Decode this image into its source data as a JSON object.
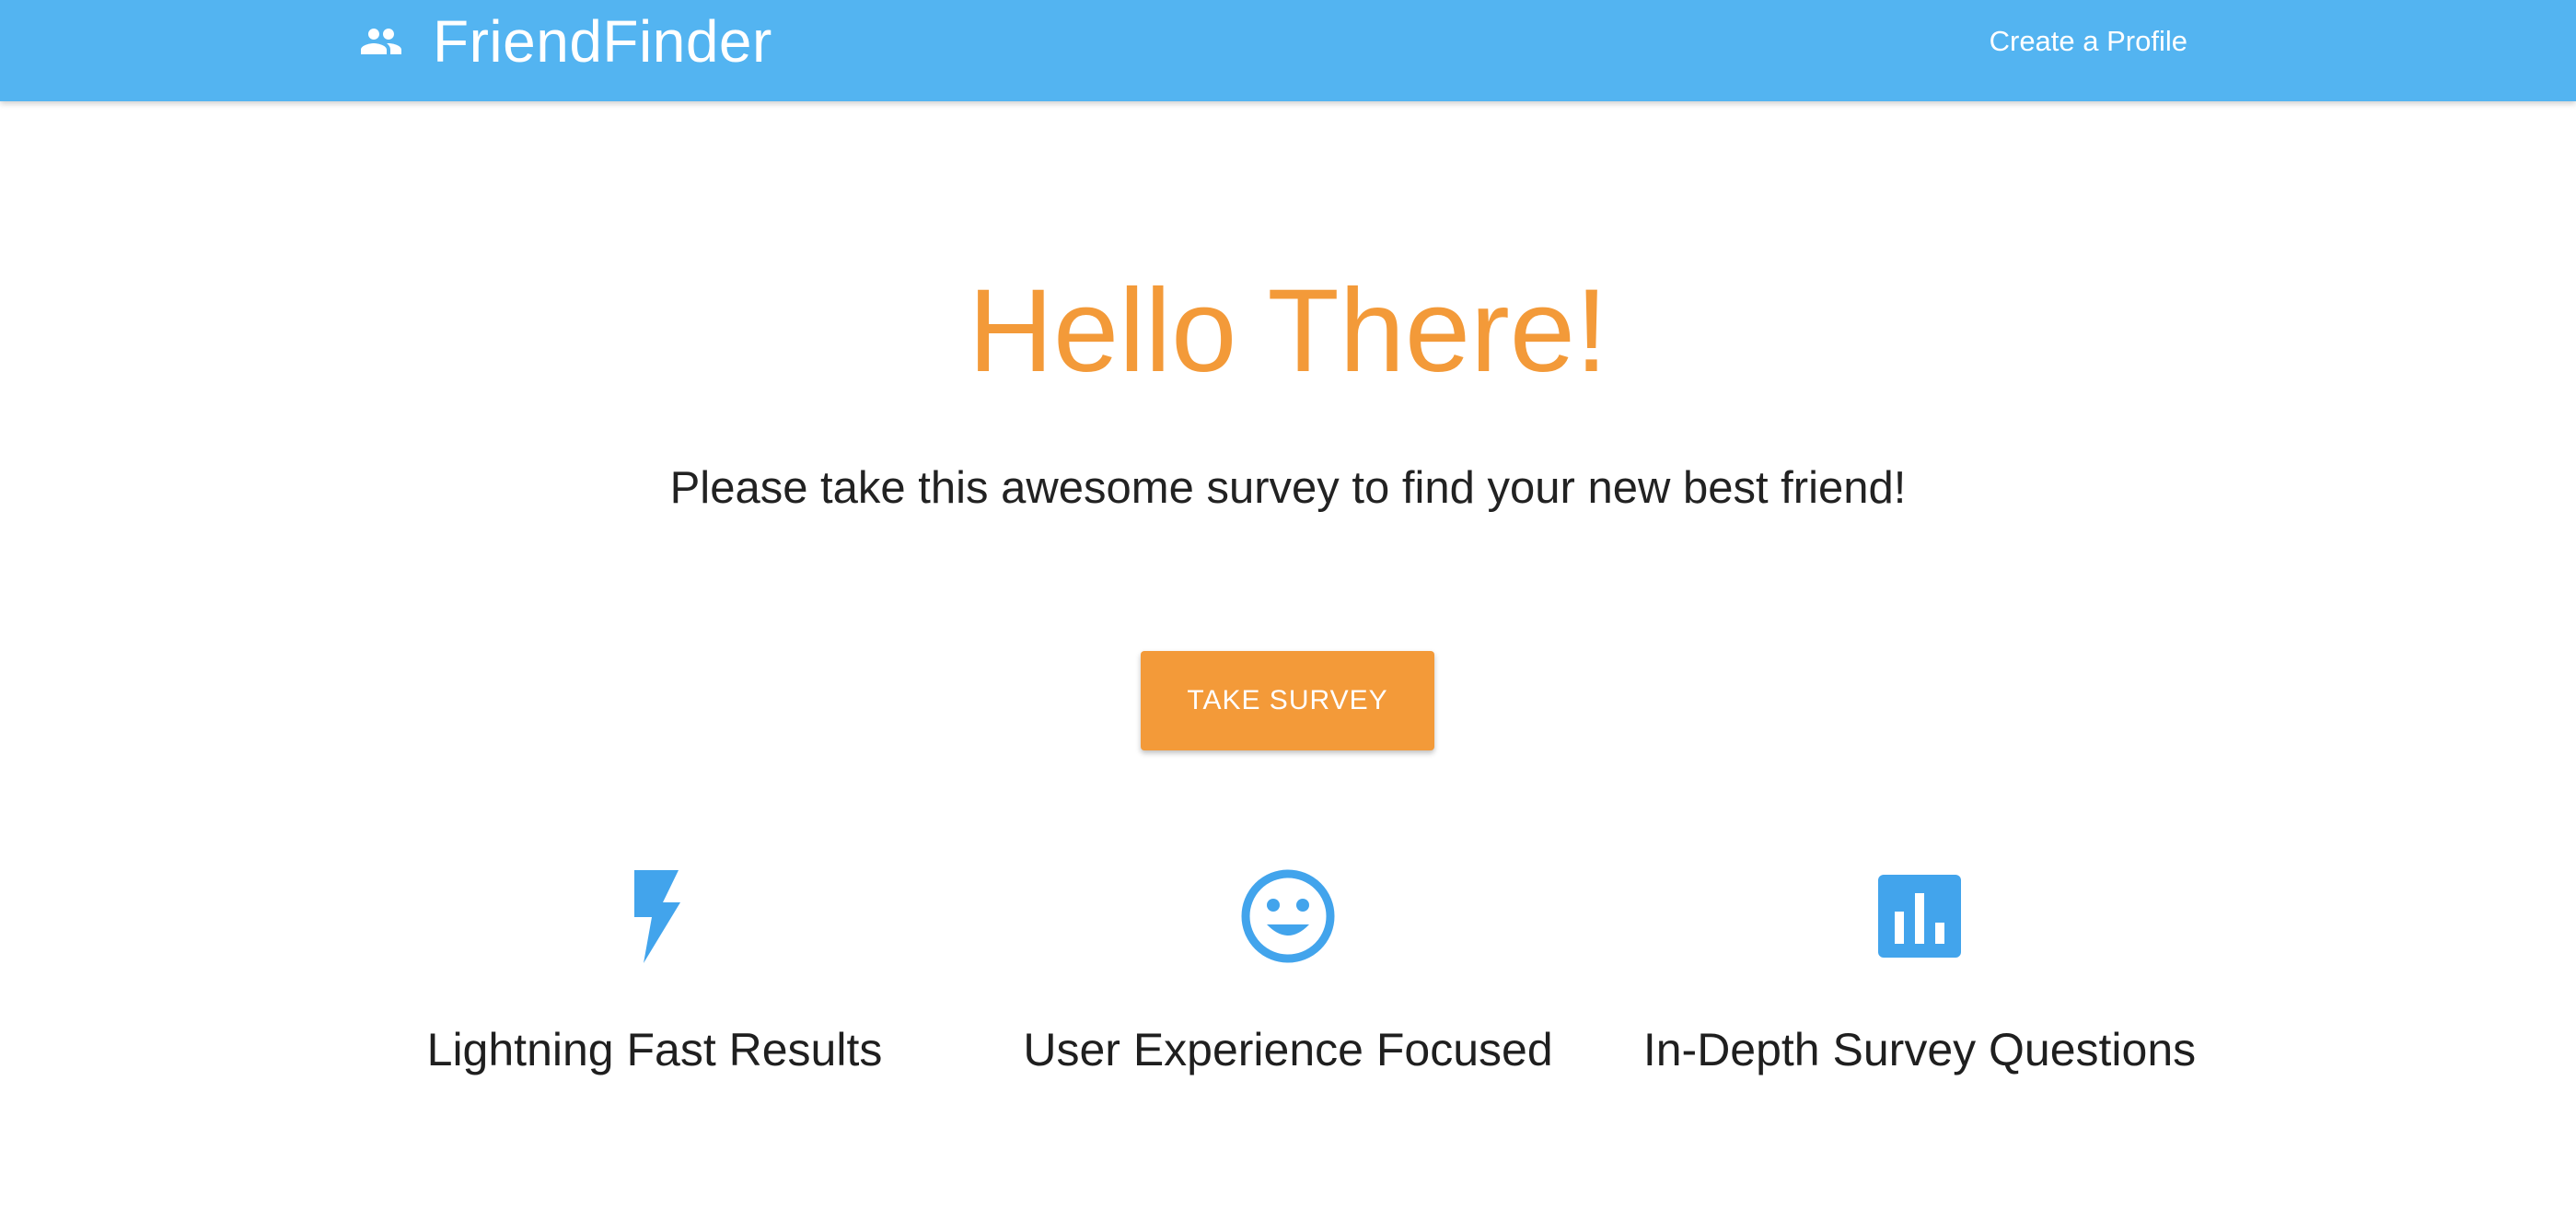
{
  "navbar": {
    "brand_icon": "people-icon",
    "brand_name": "FriendFinder",
    "link_label": "Create a Profile"
  },
  "hero": {
    "title": "Hello There!",
    "subtitle": "Please take this awesome survey to find your new best friend!",
    "button_label": "TAKE SURVEY"
  },
  "features": [
    {
      "icon": "lightning-icon",
      "label": "Lightning Fast Results"
    },
    {
      "icon": "smiley-face-icon",
      "label": "User Experience Focused"
    },
    {
      "icon": "bar-chart-icon",
      "label": "In-Depth Survey Questions"
    }
  ],
  "colors": {
    "navbar": "#53b4f1",
    "accent": "#f39a39",
    "icon": "#42a4ec"
  }
}
